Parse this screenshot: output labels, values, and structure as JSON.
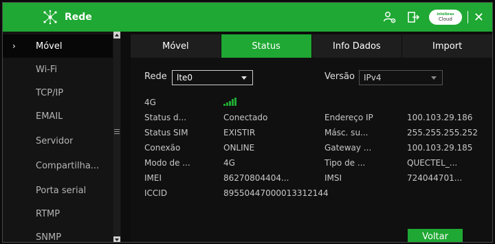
{
  "window": {
    "title": "Rede",
    "cloud_badge": {
      "line1": "intelbras",
      "line2": "Cloud"
    },
    "close_label": "✕"
  },
  "colors": {
    "accent": "#1fa833",
    "background": "#0d0d0d",
    "sidebar": "#141414"
  },
  "sidebar": {
    "items": [
      {
        "label": "Móvel",
        "active": true
      },
      {
        "label": "Wi-Fi"
      },
      {
        "label": "TCP/IP"
      },
      {
        "label": "EMAIL"
      },
      {
        "label": "Servidor"
      },
      {
        "label": "Compartilha..."
      },
      {
        "label": "Porta serial"
      },
      {
        "label": "RTMP"
      },
      {
        "label": "SNMP"
      }
    ]
  },
  "tabs": [
    {
      "label": "Móvel"
    },
    {
      "label": "Status",
      "active": true
    },
    {
      "label": "Info Dados"
    },
    {
      "label": "Import"
    }
  ],
  "status": {
    "rede_label": "Rede",
    "rede_value": "lte0",
    "versao_label": "Versão",
    "versao_value": "IPv4",
    "signal_label": "4G",
    "signal_icon": "signal-strength-icon",
    "rows": [
      {
        "label": "Status d...",
        "value": "Conectado",
        "label2": "Endereço IP",
        "value2": "100.103.29.186"
      },
      {
        "label": "Status SIM",
        "value": "EXISTIR",
        "label2": "Másc. su...",
        "value2": "255.255.255.252"
      },
      {
        "label": "Conexão",
        "value": "ONLINE",
        "label2": "Gateway ...",
        "value2": "100.103.29.185"
      },
      {
        "label": "Modo de ...",
        "value": "4G",
        "label2": "Tipo de ...",
        "value2": "QUECTEL_..."
      },
      {
        "label": "IMEI",
        "value": "86270804404...",
        "label2": "IMSI",
        "value2": "724044701..."
      }
    ],
    "iccid_label": "ICCID",
    "iccid_value": "89550447000013312144"
  },
  "buttons": {
    "back": "Voltar"
  }
}
